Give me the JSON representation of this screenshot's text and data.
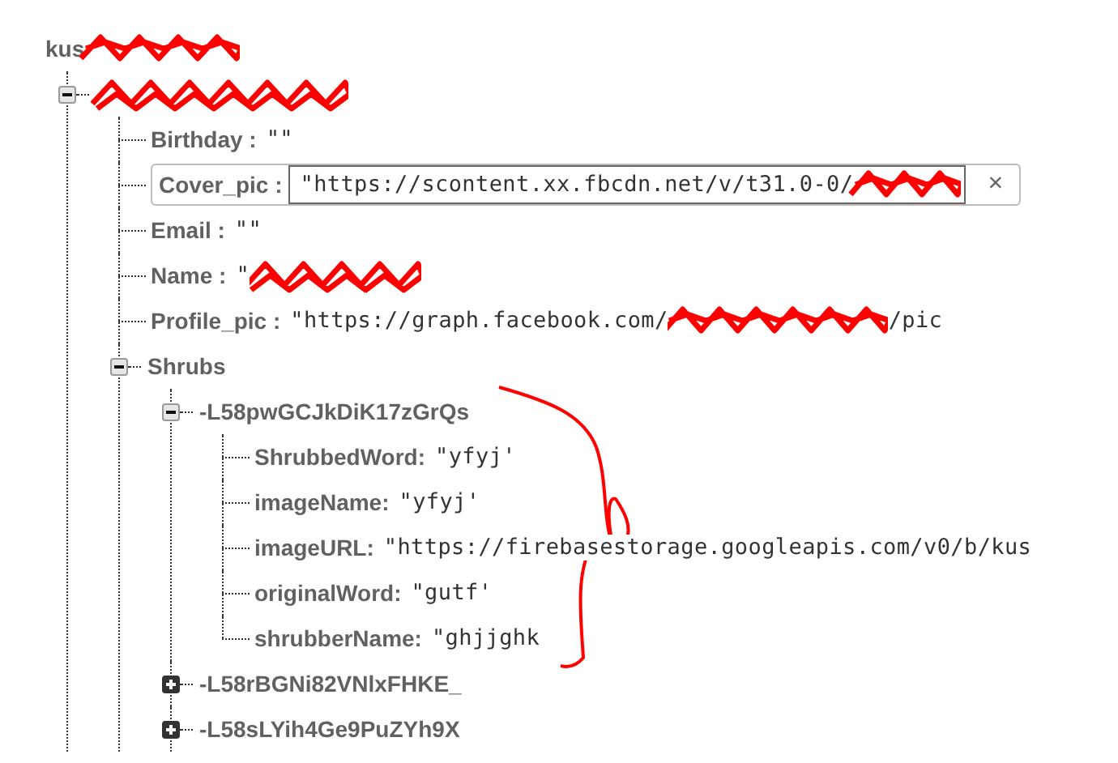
{
  "tree": {
    "key": "kus",
    "redacted": true,
    "children": [
      {
        "redacted": true,
        "expanded": true,
        "children": [
          {
            "key": "Birthday :",
            "value": [
              "\"\""
            ]
          },
          {
            "key": "Cover_pic :",
            "editing": true,
            "close_label": "×",
            "value": [
              "\"https://scontent.xx.fbcdn.net/v/t31.0-0/"
            ],
            "redacted": true
          },
          {
            "key": "Email :",
            "value": [
              "\"\""
            ]
          },
          {
            "key": "Name :",
            "value": [
              "\""
            ],
            "redacted": true
          },
          {
            "key": "Profile_pic :",
            "value": [
              "\"https://graph.facebook.com/",
              "/pic"
            ]
          },
          {
            "key": "Shrubs",
            "expanded": true,
            "children": [
              {
                "key": "-L58pwGCJkDiK17zGrQs",
                "expanded": true,
                "children": [
                  {
                    "key": "ShrubbedWord:",
                    "value": [
                      "\"yfyj'"
                    ]
                  },
                  {
                    "key": "imageName:",
                    "value": [
                      "\"yfyj'"
                    ]
                  },
                  {
                    "key": "imageURL:",
                    "value": [
                      "\"https://firebasestorage.googleapis.com/v0/b/kus"
                    ]
                  },
                  {
                    "key": "originalWord:",
                    "value": [
                      "\"gutf'"
                    ]
                  },
                  {
                    "key": "shrubberName:",
                    "value": [
                      "\"ghjjghk"
                    ]
                  }
                ]
              },
              {
                "key": "-L58rBGNi82VNlxFHKE_",
                "expanded": false
              },
              {
                "key": "-L58sLYih4Ge9PuZYh9X",
                "expanded": false
              }
            ]
          }
        ]
      }
    ]
  }
}
